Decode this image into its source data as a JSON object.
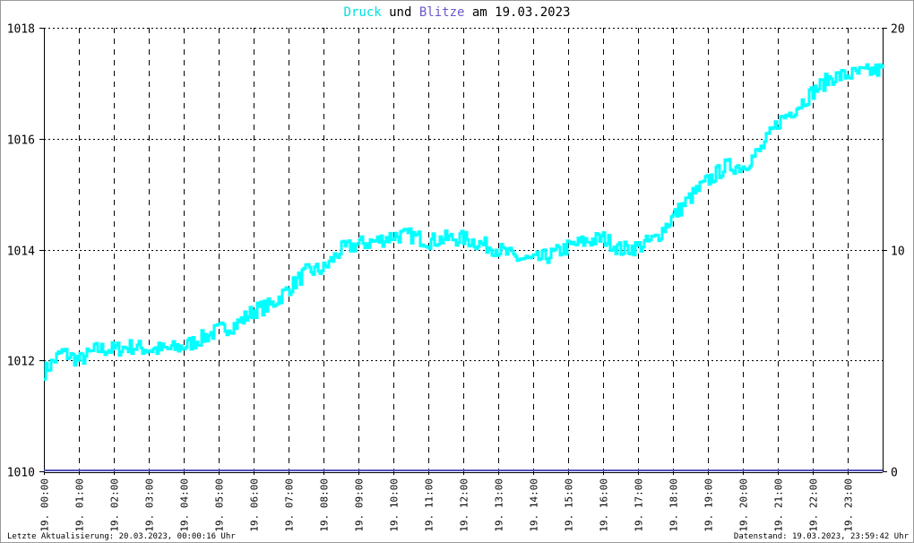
{
  "chart_data": {
    "type": "line",
    "title": {
      "part1": "Druck",
      "part2": " und ",
      "part3": "Blitze",
      "part4": " am 19.03.2023"
    },
    "colors": {
      "pressure": "#00ffff",
      "lightning": "#5050c0",
      "title_druck": "#00e0e0",
      "title_blitze": "#6a5acd"
    },
    "y_left": {
      "range": [
        1010,
        1018
      ],
      "ticks": [
        "1010",
        "1012",
        "1014",
        "1016",
        "1018"
      ]
    },
    "y_right": {
      "range": [
        0,
        20
      ],
      "ticks": [
        "0",
        "10",
        "20"
      ]
    },
    "x_range_hours": [
      0,
      24
    ],
    "x_ticks": [
      "19. 00:00",
      "19. 01:00",
      "19. 02:00",
      "19. 03:00",
      "19. 04:00",
      "19. 05:00",
      "19. 06:00",
      "19. 07:00",
      "19. 08:00",
      "19. 09:00",
      "19. 10:00",
      "19. 11:00",
      "19. 12:00",
      "19. 13:00",
      "19. 14:00",
      "19. 15:00",
      "19. 16:00",
      "19. 17:00",
      "19. 18:00",
      "19. 19:00",
      "19. 20:00",
      "19. 21:00",
      "19. 22:00",
      "19. 23:00"
    ],
    "grid": true,
    "series": [
      {
        "name": "Druck",
        "axis": "left",
        "x_hours": [
          0,
          0.5,
          1,
          1.5,
          2,
          2.5,
          3,
          3.5,
          4,
          4.5,
          5,
          5.5,
          6,
          6.5,
          7,
          7.5,
          8,
          8.5,
          9,
          9.5,
          10,
          10.5,
          11,
          11.5,
          12,
          12.5,
          13,
          13.5,
          14,
          14.5,
          15,
          15.5,
          16,
          16.5,
          17,
          17.5,
          18,
          18.5,
          19,
          19.5,
          20,
          20.5,
          21,
          21.5,
          22,
          22.5,
          23,
          23.5,
          24
        ],
        "values": [
          1011.8,
          1012.15,
          1012.0,
          1012.2,
          1012.2,
          1012.25,
          1012.2,
          1012.2,
          1012.25,
          1012.4,
          1012.55,
          1012.65,
          1012.9,
          1013.0,
          1013.3,
          1013.6,
          1013.65,
          1014.0,
          1014.1,
          1014.15,
          1014.25,
          1014.25,
          1014.15,
          1014.2,
          1014.2,
          1014.1,
          1014.0,
          1013.85,
          1013.8,
          1013.9,
          1014.05,
          1014.15,
          1014.2,
          1014.0,
          1014.05,
          1014.2,
          1014.6,
          1014.95,
          1015.25,
          1015.5,
          1015.5,
          1015.8,
          1016.3,
          1016.55,
          1016.85,
          1017.1,
          1017.15,
          1017.2,
          1017.25
        ]
      },
      {
        "name": "Blitze",
        "axis": "right",
        "x_hours": [
          0,
          24
        ],
        "values": [
          0,
          0
        ]
      }
    ]
  },
  "footer": {
    "last_update": "Letzte Aktualisierung: 20.03.2023, 00:00:16 Uhr",
    "data_state": "Datenstand: 19.03.2023, 23:59:42 Uhr"
  }
}
